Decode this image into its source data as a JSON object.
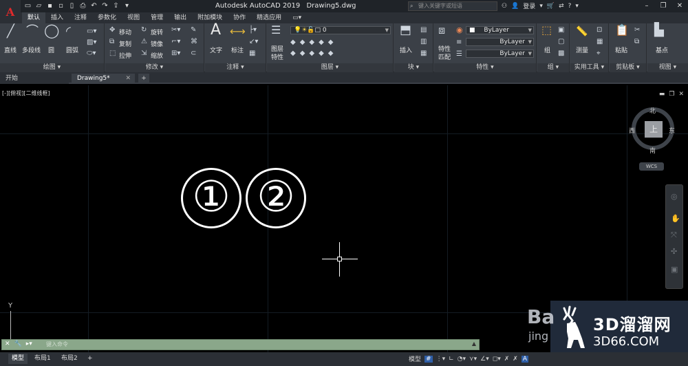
{
  "title": {
    "app": "Autodesk AutoCAD 2019",
    "file": "Drawing5.dwg"
  },
  "app_button": "A",
  "search": {
    "placeholder": "键入关键字或短语"
  },
  "user": {
    "login": "登录"
  },
  "help": "?",
  "ribbon_tabs": [
    "默认",
    "插入",
    "注释",
    "参数化",
    "视图",
    "管理",
    "输出",
    "附加模块",
    "协作",
    "精选应用"
  ],
  "panels": {
    "draw": {
      "title": "绘图",
      "line": "直线",
      "polyline": "多段线",
      "circle": "圆",
      "arc": "圆弧"
    },
    "modify": {
      "title": "修改",
      "move": "移动",
      "rotate": "旋转",
      "copy": "复制",
      "mirror": "镜像",
      "stretch": "拉伸",
      "scale": "缩放"
    },
    "annotation": {
      "title": "注释",
      "text": "文字",
      "dimension": "标注"
    },
    "layers": {
      "title": "图层",
      "props_line1": "图层",
      "props_line2": "特性",
      "current_layer": "0"
    },
    "block": {
      "title": "块",
      "insert": "插入"
    },
    "properties": {
      "title": "特性",
      "match_line1": "特性",
      "match_line2": "匹配",
      "color": "ByLayer",
      "linetype": "ByLayer",
      "lineweight": "ByLayer"
    },
    "groups": {
      "title": "组",
      "group": "组"
    },
    "utilities": {
      "title": "实用工具",
      "measure": "测量"
    },
    "clipboard": {
      "title": "剪贴板",
      "paste": "粘贴"
    },
    "view": {
      "title": "视图",
      "base": "基点"
    }
  },
  "doc_tabs": {
    "start": "开始",
    "file": "Drawing5*"
  },
  "viewport_label": "[-][俯视][二维线框]",
  "content": {
    "circled1": "①",
    "circled2": "②"
  },
  "viewcube": {
    "top_face": "上",
    "north": "北",
    "south": "南",
    "east": "东",
    "west": "西",
    "wcs": "WCS"
  },
  "ucs": {
    "y": "Y"
  },
  "command": {
    "placeholder": "键入命令"
  },
  "layout_tabs": [
    "模型",
    "布局1",
    "布局2"
  ],
  "status": {
    "model": "模型"
  },
  "watermark": {
    "cn": "3D溜溜网",
    "en": "3D66.COM",
    "bai": "Ba",
    "jing": "jing"
  }
}
